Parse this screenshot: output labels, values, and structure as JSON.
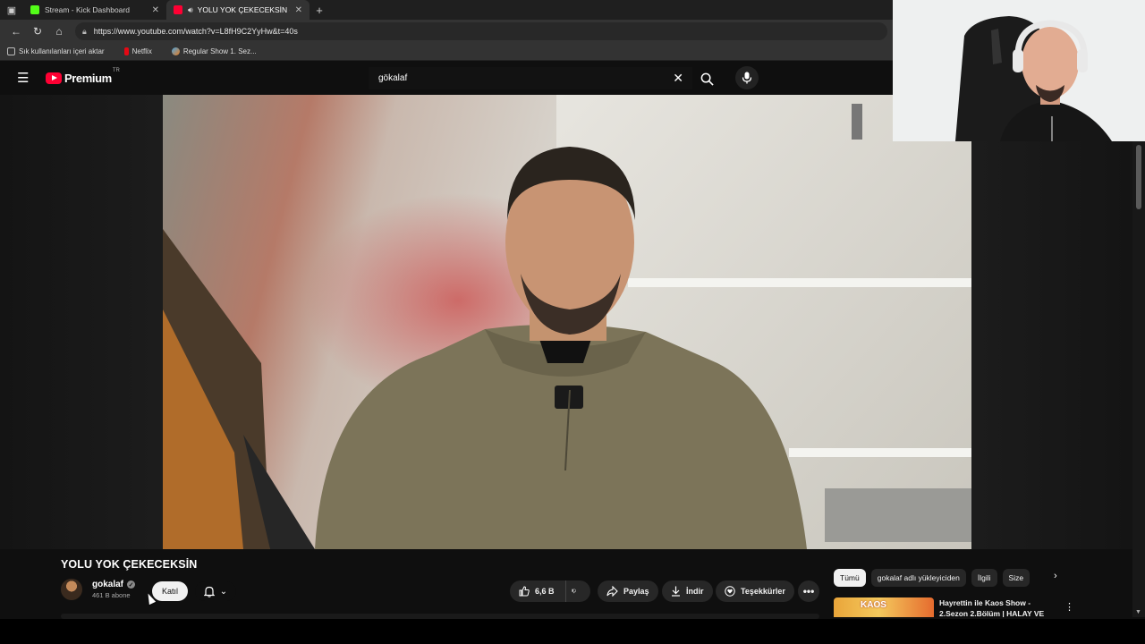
{
  "browser": {
    "tabs": [
      {
        "title": "Stream - Kick Dashboard",
        "active": false
      },
      {
        "title": "YOLU YOK ÇEKECEKSİN - YouTube",
        "active": true
      }
    ],
    "url": "https://www.youtube.com/watch?v=L8fH9C2YyHw&t=40s",
    "bookmarks": [
      "Sık kullanılanları içeri aktar",
      "Netflix",
      "Regular Show 1. Sez..."
    ]
  },
  "youtube": {
    "logo_text": "Premium",
    "region": "TR",
    "search_query": "gökalaf"
  },
  "video": {
    "title": "YOLU YOK ÇEKECEKSİN",
    "channel": "gokalaf",
    "subscribers": "461 B abone",
    "join_label": "Katıl",
    "likes": "6,6 B",
    "share_label": "Paylaş",
    "download_label": "İndir",
    "thanks_label": "Teşekkürler"
  },
  "sidebar": {
    "chips": [
      "Tümü",
      "gokalaf adlı yükleyiciden",
      "İlgili",
      "Size"
    ],
    "recommendation": {
      "thumb_text": "KAOS",
      "title": "Hayrettin ile Kaos Show - 2.Sezon 2.Bölüm | HALAY VE"
    }
  },
  "colors": {
    "yt_red": "#ff0033",
    "kick_green": "#53fc18",
    "background": "#0f0f0f"
  }
}
